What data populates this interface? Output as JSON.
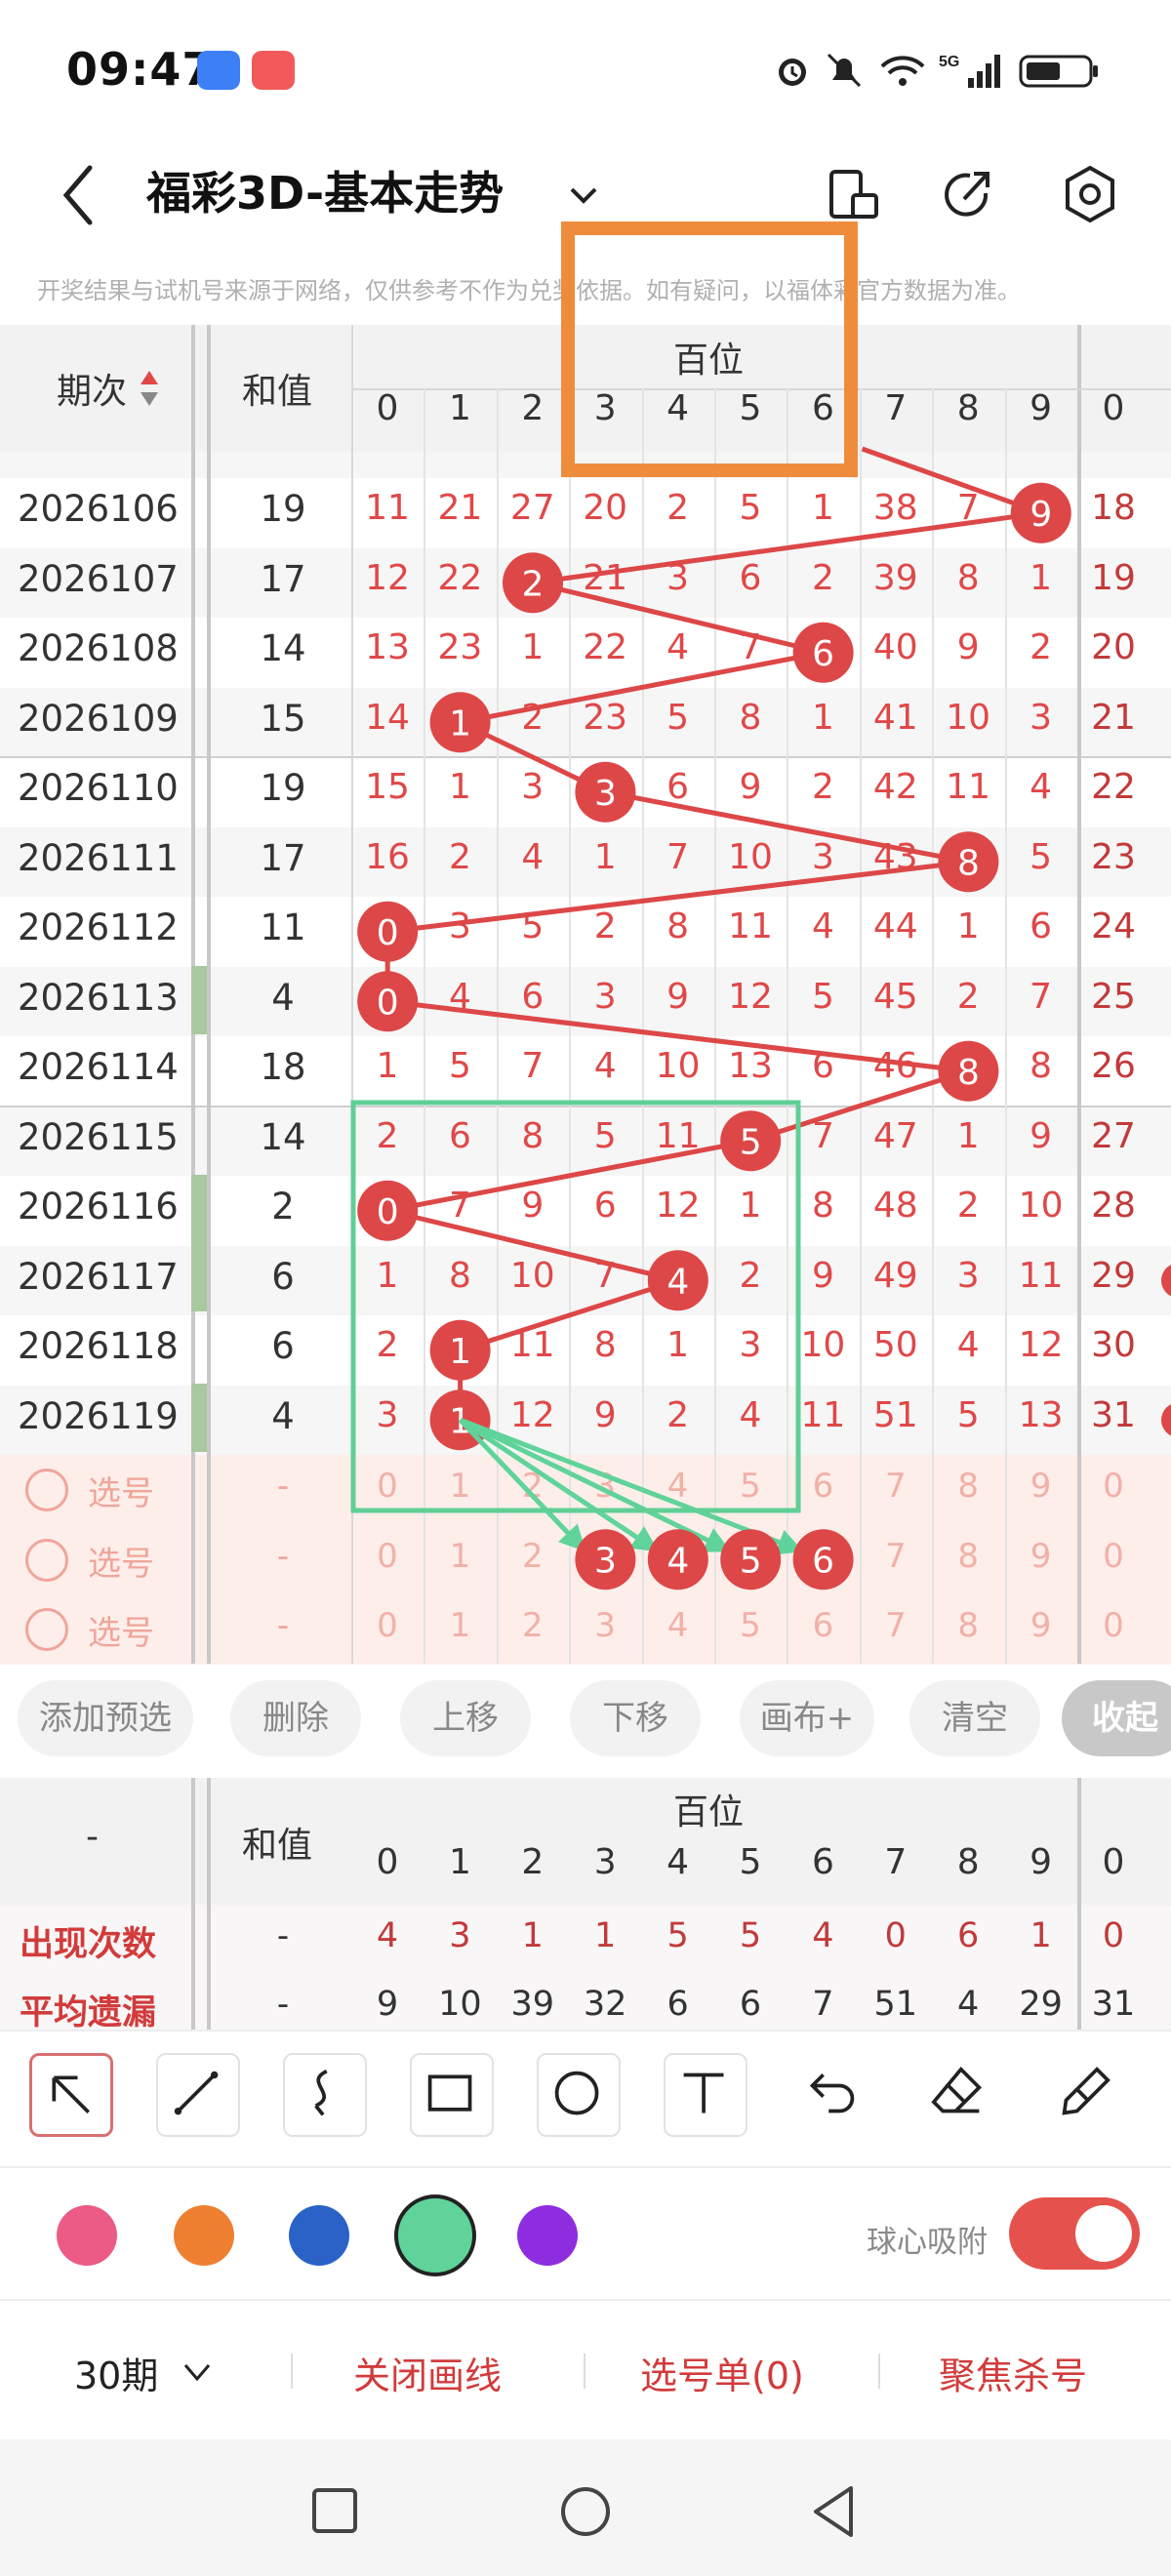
{
  "status": {
    "time": "09:47"
  },
  "nav": {
    "title": "福彩3D-基本走势"
  },
  "disclaimer": "开奖结果与试机号来源于网络，仅供参考不作为兑奖依据。如有疑问，以福体彩官方数据为准。",
  "table": {
    "col_period": "期次",
    "col_sum": "和值",
    "group": "百位",
    "digits": [
      "0",
      "1",
      "2",
      "3",
      "4",
      "5",
      "6",
      "7",
      "8",
      "9",
      "0"
    ],
    "rows": [
      {
        "period": "2026106",
        "sum": "19",
        "cells": [
          "11",
          "21",
          "27",
          "20",
          "2",
          "5",
          "1",
          "38",
          "7",
          "9",
          "18"
        ],
        "ball": 9
      },
      {
        "period": "2026107",
        "sum": "17",
        "cells": [
          "12",
          "22",
          "2",
          "21",
          "3",
          "6",
          "2",
          "39",
          "8",
          "1",
          "19"
        ],
        "ball": 2
      },
      {
        "period": "2026108",
        "sum": "14",
        "cells": [
          "13",
          "23",
          "1",
          "22",
          "4",
          "7",
          "6",
          "40",
          "9",
          "2",
          "20"
        ],
        "ball": 6
      },
      {
        "period": "2026109",
        "sum": "15",
        "cells": [
          "14",
          "1",
          "2",
          "23",
          "5",
          "8",
          "1",
          "41",
          "10",
          "3",
          "21"
        ],
        "ball": 1
      },
      {
        "period": "2026110",
        "sum": "19",
        "cells": [
          "15",
          "1",
          "3",
          "3",
          "6",
          "9",
          "2",
          "42",
          "11",
          "4",
          "22"
        ],
        "ball": 3
      },
      {
        "period": "2026111",
        "sum": "17",
        "cells": [
          "16",
          "2",
          "4",
          "1",
          "7",
          "10",
          "3",
          "43",
          "8",
          "5",
          "23"
        ],
        "ball": 8
      },
      {
        "period": "2026112",
        "sum": "11",
        "cells": [
          "0",
          "3",
          "5",
          "2",
          "8",
          "11",
          "4",
          "44",
          "1",
          "6",
          "24"
        ],
        "ball": 0
      },
      {
        "period": "2026113",
        "sum": "4",
        "cells": [
          "0",
          "4",
          "6",
          "3",
          "9",
          "12",
          "5",
          "45",
          "2",
          "7",
          "25"
        ],
        "ball": 0
      },
      {
        "period": "2026114",
        "sum": "18",
        "cells": [
          "1",
          "5",
          "7",
          "4",
          "10",
          "13",
          "6",
          "46",
          "8",
          "8",
          "26"
        ],
        "ball": 8
      },
      {
        "period": "2026115",
        "sum": "14",
        "cells": [
          "2",
          "6",
          "8",
          "5",
          "11",
          "5",
          "7",
          "47",
          "1",
          "9",
          "27"
        ],
        "ball": 5
      },
      {
        "period": "2026116",
        "sum": "2",
        "cells": [
          "0",
          "7",
          "9",
          "6",
          "12",
          "1",
          "8",
          "48",
          "2",
          "10",
          "28"
        ],
        "ball": 0
      },
      {
        "period": "2026117",
        "sum": "6",
        "cells": [
          "1",
          "8",
          "10",
          "7",
          "4",
          "2",
          "9",
          "49",
          "3",
          "11",
          "29"
        ],
        "ball": 4
      },
      {
        "period": "2026118",
        "sum": "6",
        "cells": [
          "2",
          "1",
          "11",
          "8",
          "1",
          "3",
          "10",
          "50",
          "4",
          "12",
          "30"
        ],
        "ball": 1
      },
      {
        "period": "2026119",
        "sum": "4",
        "cells": [
          "3",
          "1",
          "12",
          "9",
          "2",
          "4",
          "11",
          "51",
          "5",
          "13",
          "31"
        ],
        "ball": 1
      }
    ],
    "pick_label": "选号",
    "pick_dash": "-",
    "pick_digits": [
      "0",
      "1",
      "2",
      "3",
      "4",
      "5",
      "6",
      "7",
      "8",
      "9",
      "0"
    ],
    "pick_balls": [
      3,
      4,
      5,
      6
    ]
  },
  "actions": [
    "添加预选",
    "删除",
    "上移",
    "下移",
    "画布+",
    "清空",
    "收起"
  ],
  "stats": {
    "col_dash": "-",
    "col_sum": "和值",
    "group": "百位",
    "rows": [
      {
        "label": "出现次数",
        "dash": "-",
        "cells": [
          "4",
          "3",
          "1",
          "1",
          "5",
          "5",
          "4",
          "0",
          "6",
          "1",
          "0"
        ]
      },
      {
        "label": "平均遗漏",
        "dash": "-",
        "cells": [
          "9",
          "10",
          "39",
          "32",
          "6",
          "6",
          "7",
          "51",
          "4",
          "29",
          "31"
        ]
      }
    ]
  },
  "tools": [
    "select-arrow",
    "line",
    "curve",
    "rectangle",
    "circle",
    "text",
    "undo",
    "eraser",
    "brush"
  ],
  "colors": {
    "swatches": [
      "#ec5a86",
      "#ef8030",
      "#2a62c8",
      "#5fd39a",
      "#8e2de0"
    ],
    "snap_label": "球心吸附"
  },
  "bottom": {
    "periods": "30期",
    "close_lines": "关闭画线",
    "pick_list": "选号单(0)",
    "focus_kill": "聚焦杀号"
  }
}
